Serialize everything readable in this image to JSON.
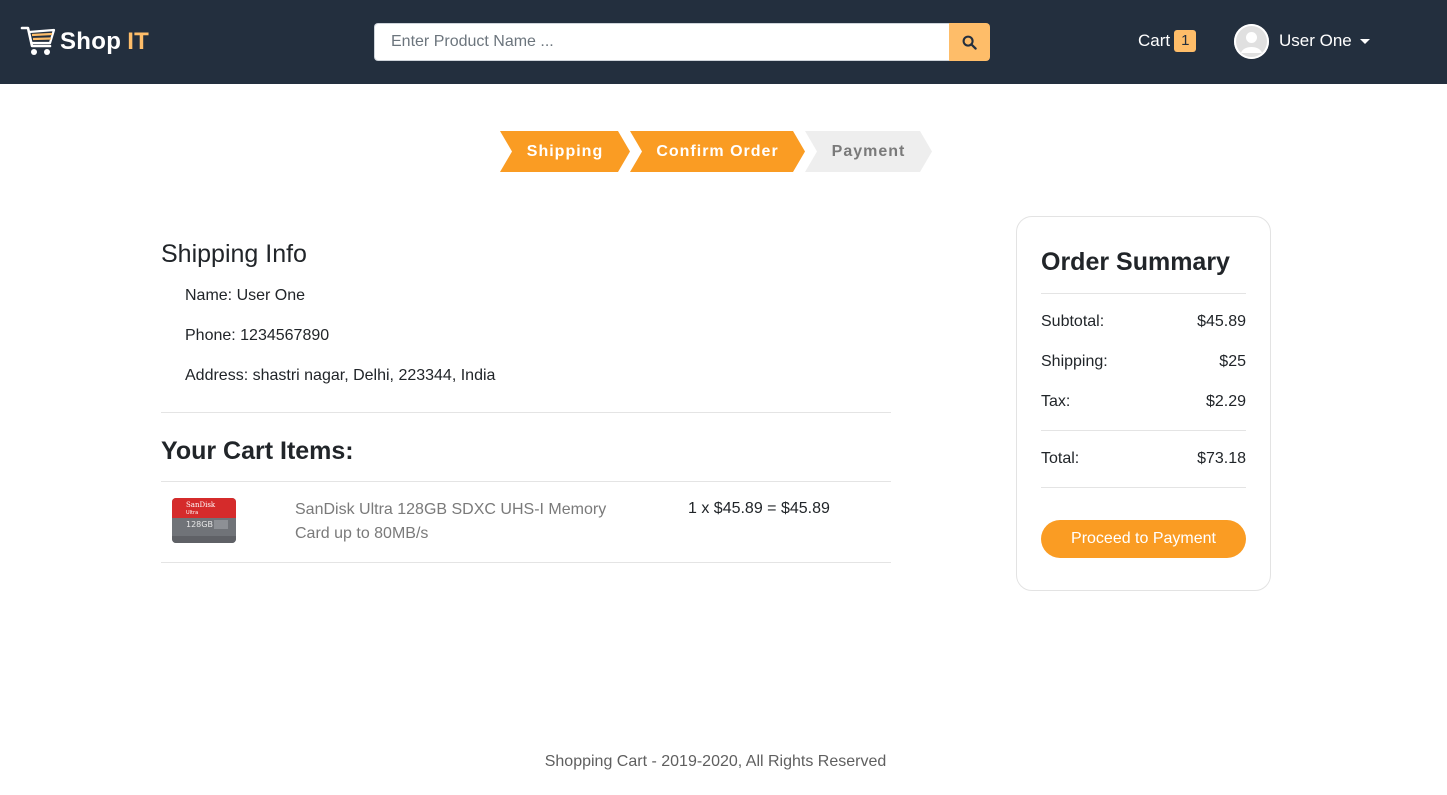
{
  "header": {
    "brand_main": "Shop",
    "brand_accent": "IT",
    "logo_icon": "shopping-cart-icon",
    "search": {
      "placeholder": "Enter Product Name ...",
      "value": ""
    },
    "cart_label": "Cart",
    "cart_count": "1",
    "user_name": "User One",
    "avatar_icon": "user-avatar-icon"
  },
  "steps": [
    {
      "label": "Shipping",
      "state": "active"
    },
    {
      "label": "Confirm Order",
      "state": "active"
    },
    {
      "label": "Payment",
      "state": "incomplete"
    }
  ],
  "shipping_info": {
    "title": "Shipping Info",
    "name_line": "Name: User One",
    "phone_line": "Phone: 1234567890",
    "address_line": "Address: shastri nagar, Delhi, 223344, India"
  },
  "cart": {
    "title": "Your Cart Items:",
    "items": [
      {
        "name": "SanDisk Ultra 128GB SDXC UHS-I Memory Card up to 80MB/s",
        "price_line": "1 x $45.89 = $45.89",
        "image_brand": "SanDisk",
        "image_line": "Ultra",
        "image_capacity": "128GB"
      }
    ]
  },
  "order_summary": {
    "title": "Order Summary",
    "subtotal_label": "Subtotal:",
    "subtotal_value": "$45.89",
    "shipping_label": "Shipping:",
    "shipping_value": "$25",
    "tax_label": "Tax:",
    "tax_value": "$2.29",
    "total_label": "Total:",
    "total_value": "$73.18",
    "button_label": "Proceed to Payment"
  },
  "footer": {
    "text": "Shopping Cart - 2019-2020, All Rights Reserved"
  },
  "colors": {
    "navbar_bg": "#232f3e",
    "accent": "#febd69",
    "step_active": "#fa9c23",
    "step_incomplete": "#eeeeee"
  }
}
